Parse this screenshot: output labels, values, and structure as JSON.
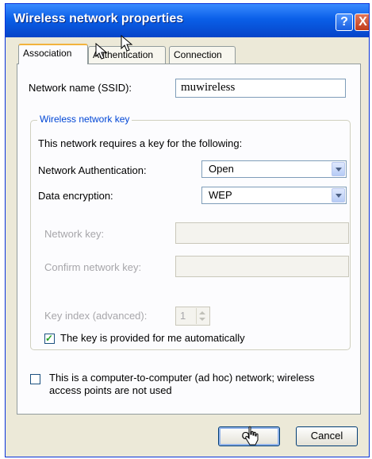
{
  "window": {
    "title": "Wireless network properties",
    "help_button": "?",
    "close_button": "X"
  },
  "tabs": [
    {
      "label": "Association",
      "active": true
    },
    {
      "label": "Authentication",
      "active": false
    },
    {
      "label": "Connection",
      "active": false
    }
  ],
  "association": {
    "ssid_label": "Network name (SSID):",
    "ssid_value": "muwireless",
    "group_title": "Wireless network key",
    "key_required_text": "This network requires a key for the following:",
    "auth_label": "Network Authentication:",
    "auth_value": "Open",
    "encryption_label": "Data encryption:",
    "encryption_value": "WEP",
    "network_key_label": "Network key:",
    "confirm_key_label": "Confirm network key:",
    "key_index_label": "Key index (advanced):",
    "key_index_value": "1",
    "auto_key_label": "The key is provided for me automatically",
    "auto_key_checked": true,
    "adhoc_label_line1": "This is a computer-to-computer (ad hoc) network; wireless",
    "adhoc_label_line2": "access points are not used",
    "adhoc_checked": false
  },
  "buttons": {
    "ok": "OK",
    "cancel": "Cancel"
  },
  "colors": {
    "titlebar": "#0a5fe8",
    "group_title": "#0046d5",
    "checkmark": "#21a121"
  }
}
